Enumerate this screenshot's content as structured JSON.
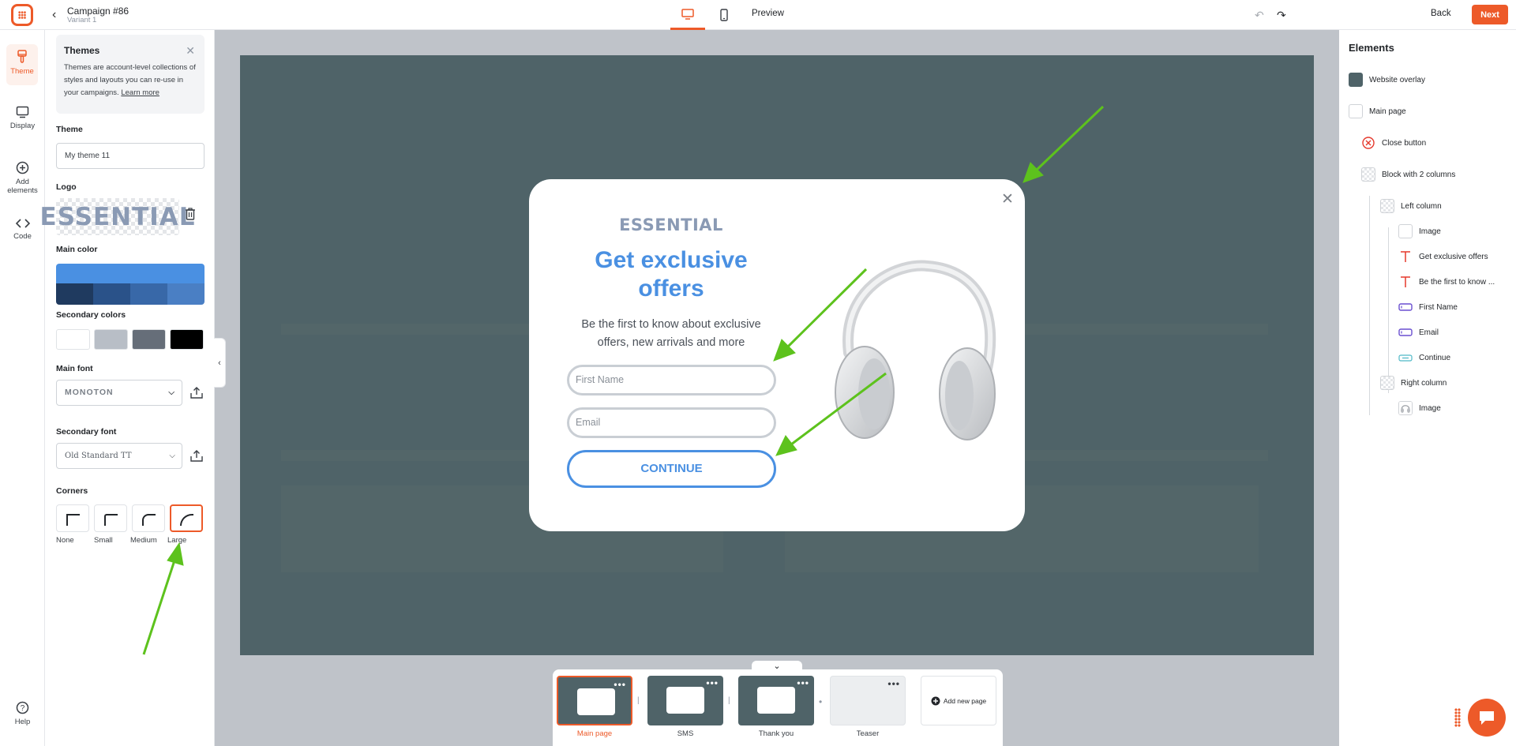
{
  "header": {
    "title": "Campaign #86",
    "variant": "Variant 1",
    "preview": "Preview",
    "back": "Back",
    "next": "Next"
  },
  "nav": {
    "theme": "Theme",
    "display": "Display",
    "add_elements_1": "Add",
    "add_elements_2": "elements",
    "code": "Code",
    "help": "Help"
  },
  "panel": {
    "info_title": "Themes",
    "info_text": "Themes are account-level collections of styles and layouts you can re-use in your campaigns.",
    "info_link": "Learn more",
    "theme_label": "Theme",
    "theme_value": "My theme 11",
    "logo_label": "Logo",
    "logo_text": "ESSENTIAL",
    "main_color_label": "Main color",
    "main_color": "#4a90e2",
    "main_color_shades": [
      "#1f3a5f",
      "#2a5289",
      "#3868a8",
      "#4a7fc4"
    ],
    "secondary_label": "Secondary colors",
    "secondary_colors": [
      "#ffffff",
      "#b8bec6",
      "#666e79",
      "#000000"
    ],
    "main_font_label": "Main font",
    "main_font": "MONOTON",
    "secondary_font_label": "Secondary font",
    "secondary_font": "Old Standard TT",
    "corners_label": "Corners",
    "corners": [
      "None",
      "Small",
      "Medium",
      "Large"
    ],
    "corners_selected": "Large"
  },
  "popup": {
    "logo": "ESSENTIAL",
    "headline_1": "Get exclusive",
    "headline_2": "offers",
    "subtext": "Be the first to know about exclusive offers, new arrivals and more",
    "first_name_placeholder": "First Name",
    "email_placeholder": "Email",
    "button": "CONTINUE",
    "accent": "#4a90e2"
  },
  "pages": {
    "items": [
      "Main page",
      "SMS",
      "Thank you",
      "Teaser"
    ],
    "selected": "Main page",
    "add": "Add new page"
  },
  "elements": {
    "title": "Elements",
    "items": [
      "Website overlay",
      "Main page",
      "Close button",
      "Block with 2 columns",
      "Left column",
      "Image",
      "Get exclusive offers",
      "Be the first to know ...",
      "First Name",
      "Email",
      "Continue",
      "Right column",
      "Image"
    ]
  },
  "colors": {
    "brand": "#ed5a29",
    "overlay": "#4f6368"
  }
}
